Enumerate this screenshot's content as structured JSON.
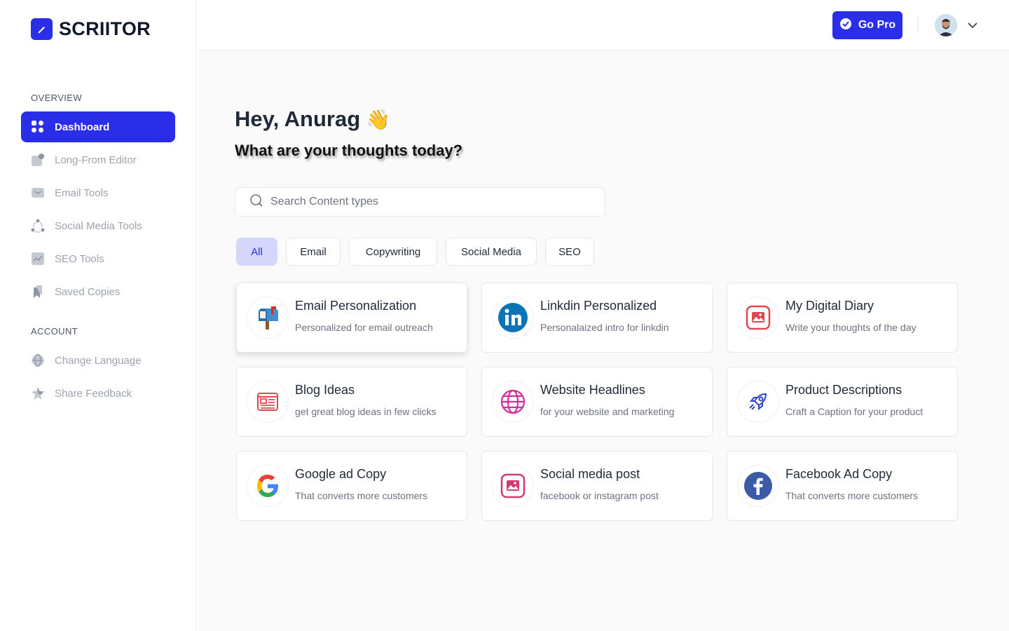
{
  "app": {
    "name": "SCRIITOR"
  },
  "sidebar": {
    "overview_label": "OVERVIEW",
    "account_label": "ACCOUNT",
    "items": [
      {
        "label": "Dashboard",
        "icon": "grid-icon"
      },
      {
        "label": "Long-From Editor",
        "icon": "edit-icon"
      },
      {
        "label": "Email Tools",
        "icon": "mail-icon"
      },
      {
        "label": "Social Media Tools",
        "icon": "share-icon"
      },
      {
        "label": "SEO Tools",
        "icon": "chart-icon"
      },
      {
        "label": "Saved Copies",
        "icon": "bookmark-icon"
      }
    ],
    "account_items": [
      {
        "label": "Change Language",
        "icon": "globe-icon"
      },
      {
        "label": "Share Feedback",
        "icon": "star-icon"
      }
    ]
  },
  "header": {
    "go_pro_label": "Go Pro"
  },
  "main": {
    "greeting": "Hey, Anurag",
    "wave": "👋",
    "subtitle": "What are your thoughts today?",
    "search_placeholder": "Search Content types",
    "filters": [
      "All",
      "Email",
      "Copywriting",
      "Social Media",
      "SEO"
    ],
    "cards": [
      {
        "title": "Email Personalization",
        "desc": "Personalized for email outreach",
        "icon": "mailbox-icon"
      },
      {
        "title": "Linkdin Personalized",
        "desc": "Personalaized intro for linkdin",
        "icon": "linkedin-icon"
      },
      {
        "title": "My Digital Diary",
        "desc": "Write your thoughts of the day",
        "icon": "image-icon"
      },
      {
        "title": "Blog Ideas",
        "desc": "get great blog ideas in few clicks",
        "icon": "newspaper-icon"
      },
      {
        "title": "Website Headlines",
        "desc": "for your website and marketing",
        "icon": "globe-icon"
      },
      {
        "title": "Product Descriptions",
        "desc": "Craft a Caption for your product",
        "icon": "rocket-icon"
      },
      {
        "title": "Google ad Copy",
        "desc": "That converts more customers",
        "icon": "google-icon"
      },
      {
        "title": "Social media post",
        "desc": "facebook or instagram post",
        "icon": "image-icon"
      },
      {
        "title": "Facebook Ad Copy",
        "desc": "That converts more customers",
        "icon": "facebook-icon"
      }
    ]
  },
  "colors": {
    "accent": "#2b2ee8",
    "chip_active_bg": "#d4d6fb"
  }
}
